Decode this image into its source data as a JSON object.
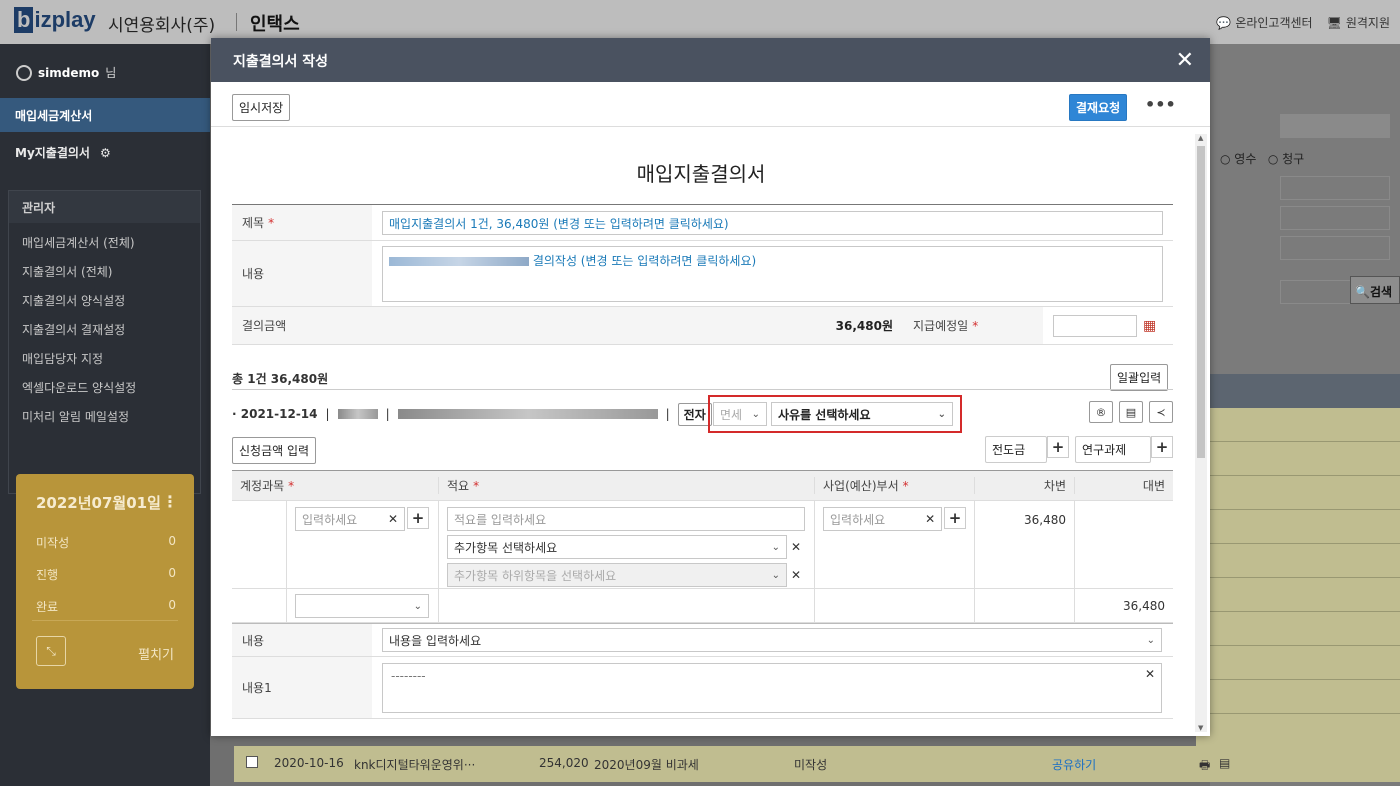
{
  "topbar": {
    "logo": "bizplay",
    "company": "시연용회사(주)",
    "product": "인택스",
    "links": [
      "온라인고객센터",
      "원격지원"
    ]
  },
  "sidebar": {
    "user": "simdemo",
    "user_suffix": "님",
    "active_item": "매입세금계산서",
    "my_item": "My지출결의서",
    "admin_title": "관리자",
    "admin_items": [
      "매입세금계산서 (전체)",
      "지출결의서 (전체)",
      "지출결의서 양식설정",
      "지출결의서 결재설정",
      "매입담당자 지정",
      "엑셀다운로드 양식설정",
      "미처리 알림 메일설정"
    ],
    "calendar": {
      "date": "2022년07월01일",
      "rows": [
        {
          "label": "미작성",
          "value": "0"
        },
        {
          "label": "진행",
          "value": "0"
        },
        {
          "label": "완료",
          "value": "0"
        }
      ],
      "expand": "펼치기"
    }
  },
  "background": {
    "radio_receipt": "영수",
    "radio_claim": "청구",
    "search": "검색",
    "bottom_row": {
      "date": "2020-10-16",
      "vendor": "knk디지털타워운영위···",
      "amount": "254,020",
      "desc": "2020년09월 비과세",
      "status": "미작성",
      "share": "공유하기"
    }
  },
  "modal": {
    "title": "지출결의서 작성",
    "temp_save": "임시저장",
    "request": "결재요청",
    "doc_title": "매입지출결의서",
    "labels": {
      "subject": "제목",
      "content": "내용",
      "amount": "결의금액",
      "pay_date": "지급예정일"
    },
    "subject_value": "매입지출결의서 1건, 36,480원 (변경 또는 입력하려면 클릭하세요)",
    "content_value": "결의작성 (변경 또는 입력하려면 클릭하세요)",
    "amount_value": "36,480원",
    "summary": "총 1건 36,480원",
    "bulk_input": "일괄입력",
    "item": {
      "date": "2021-12-14",
      "tag": "전자",
      "tax_select": "면세",
      "reason_select": "사유를 선택하세요"
    },
    "request_amount": "신청금액 입력",
    "advance": "전도금",
    "research": "연구과제",
    "grid": {
      "headers": [
        "계정과목",
        "적요",
        "사업(예산)부서",
        "차변",
        "대변"
      ],
      "account_placeholder": "입력하세요",
      "memo_placeholder": "적요를 입력하세요",
      "extra_select": "추가항목 선택하세요",
      "extra_sub_select": "추가항목 하위항목을 선택하세요",
      "dept_placeholder": "입력하세요",
      "debit": "36,480",
      "credit": "36,480"
    },
    "content_label": "내용",
    "content_select": "내용을 입력하세요",
    "content1_label": "내용1",
    "content1_value": "--------"
  }
}
